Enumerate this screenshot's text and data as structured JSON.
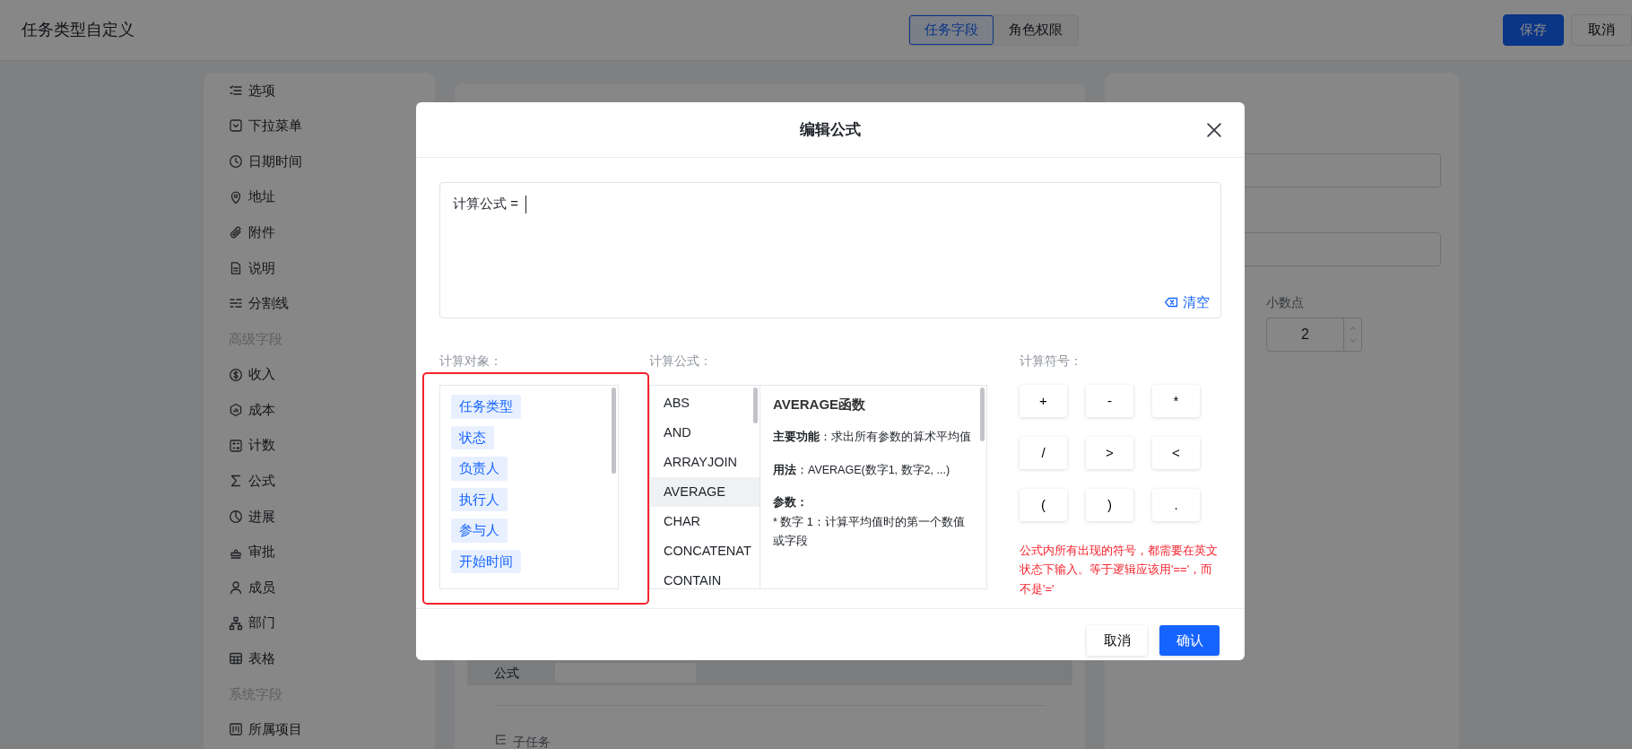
{
  "header": {
    "title": "任务类型自定义",
    "tabs": [
      {
        "label": "任务字段",
        "selected": true
      },
      {
        "label": "角色权限",
        "selected": false
      }
    ],
    "buttons": [
      {
        "label": "保存",
        "kind": "primary"
      },
      {
        "label": "取消",
        "kind": "default"
      }
    ]
  },
  "field_palette": {
    "items": [
      {
        "kind": "field",
        "label": "选项"
      },
      {
        "kind": "field",
        "label": "下拉菜单"
      },
      {
        "kind": "field",
        "label": "日期时间"
      },
      {
        "kind": "field",
        "label": "地址"
      },
      {
        "kind": "field",
        "label": "附件"
      },
      {
        "kind": "field",
        "label": "说明"
      },
      {
        "kind": "field",
        "label": "分割线"
      },
      {
        "kind": "section",
        "label": "高级字段"
      },
      {
        "kind": "field",
        "label": "收入"
      },
      {
        "kind": "field",
        "label": "成本"
      },
      {
        "kind": "field",
        "label": "计数"
      },
      {
        "kind": "field",
        "label": "公式"
      },
      {
        "kind": "field",
        "label": "进展"
      },
      {
        "kind": "field",
        "label": "审批"
      },
      {
        "kind": "field",
        "label": "成员"
      },
      {
        "kind": "field",
        "label": "部门"
      },
      {
        "kind": "field",
        "label": "表格"
      },
      {
        "kind": "section",
        "label": "系统字段"
      },
      {
        "kind": "field",
        "label": "所属项目"
      }
    ]
  },
  "canvas": {
    "formula_row": {
      "label": "公式"
    },
    "subtask": {
      "label": "子任务"
    }
  },
  "properties": {
    "decimal": {
      "label": "小数点",
      "value": "2"
    }
  },
  "modal": {
    "title": "编辑公式",
    "editor": {
      "prefix": "计算公式 =",
      "clear_label": "清空"
    },
    "objects": {
      "label": "计算对象：",
      "annotated": true,
      "items": [
        "任务类型",
        "状态",
        "负责人",
        "执行人",
        "参与人",
        "开始时间"
      ]
    },
    "functions": {
      "label": "计算公式：",
      "items": [
        {
          "name": "ABS",
          "selected": false
        },
        {
          "name": "AND",
          "selected": false
        },
        {
          "name": "ARRAYJOIN",
          "selected": false
        },
        {
          "name": "AVERAGE",
          "selected": true
        },
        {
          "name": "CHAR",
          "selected": false
        },
        {
          "name": "CONCATENAT",
          "selected": false
        },
        {
          "name": "CONTAIN",
          "selected": false
        }
      ],
      "detail": {
        "title": "AVERAGE函数",
        "paragraphs": [
          "**主要功能**：求出所有参数的算术平均值",
          "**用法**：AVERAGE(数字1, 数字2, ...)"
        ],
        "params_title": "参数：",
        "params": [
          "* 数字 1：计算平均值时的第一个数值或字段"
        ]
      }
    },
    "symbols": {
      "label": "计算符号：",
      "keys": [
        "+",
        "-",
        "*",
        "/",
        ">",
        "<",
        "(",
        ")",
        "."
      ],
      "note": "公式内所有出现的符号，都需要在英文状态下输入。等于逻辑应该用'=='，而不是'='"
    },
    "buttons": [
      {
        "label": "取消",
        "kind": "default"
      },
      {
        "label": "确认",
        "kind": "primary"
      }
    ]
  }
}
